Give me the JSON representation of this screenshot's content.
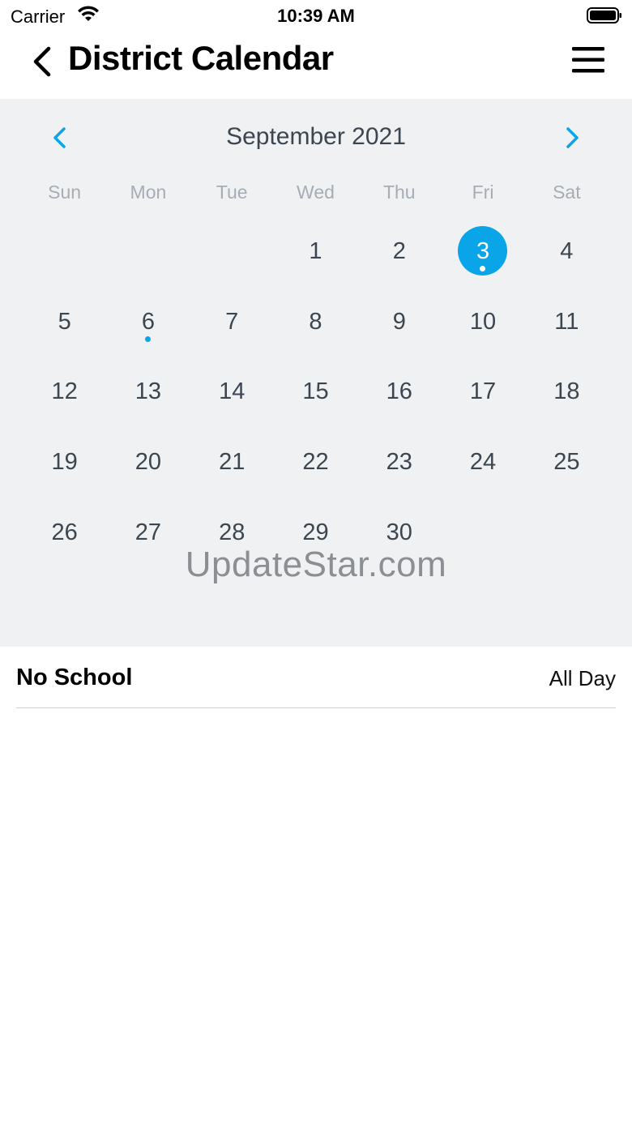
{
  "status_bar": {
    "carrier": "Carrier",
    "time": "10:39 AM"
  },
  "nav": {
    "title": "District Calendar",
    "back_icon": "chevron-left-icon",
    "menu_icon": "hamburger-menu-icon"
  },
  "calendar": {
    "month_label": "September 2021",
    "accent_color": "#0aa4e8",
    "weekdays": [
      "Sun",
      "Mon",
      "Tue",
      "Wed",
      "Thu",
      "Fri",
      "Sat"
    ],
    "weeks": [
      [
        "",
        "",
        "",
        "1",
        "2",
        "3",
        "4"
      ],
      [
        "5",
        "6",
        "7",
        "8",
        "9",
        "10",
        "11"
      ],
      [
        "12",
        "13",
        "14",
        "15",
        "16",
        "17",
        "18"
      ],
      [
        "19",
        "20",
        "21",
        "22",
        "23",
        "24",
        "25"
      ],
      [
        "26",
        "27",
        "28",
        "29",
        "30",
        "",
        ""
      ]
    ],
    "selected_day": "3",
    "event_days": [
      "3",
      "6"
    ]
  },
  "watermark": "UpdateStar.com",
  "events": [
    {
      "title": "No School",
      "time": "All Day"
    }
  ]
}
